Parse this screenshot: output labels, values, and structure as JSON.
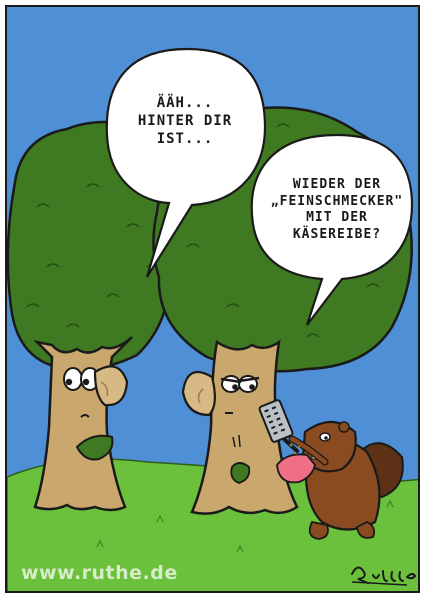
{
  "comic": {
    "colors": {
      "sky": "#4f8fd6",
      "grass": "#6cc13c",
      "foliage": "#3f7a23",
      "trunk": "#c9a76d",
      "beaver": "#8a4b21",
      "tongue": "#ef6f86"
    },
    "speech_bubble_1": {
      "lines": [
        "ÄÄH...",
        "HINTER DIR",
        "IST..."
      ]
    },
    "speech_bubble_2": {
      "lines": [
        "WIEDER DER",
        "„FEINSCHMECKER\"",
        "MIT DER",
        "KÄSEREIBE?"
      ]
    },
    "watermark": "www.ruthe.de",
    "signature_text": "Ruthe"
  }
}
